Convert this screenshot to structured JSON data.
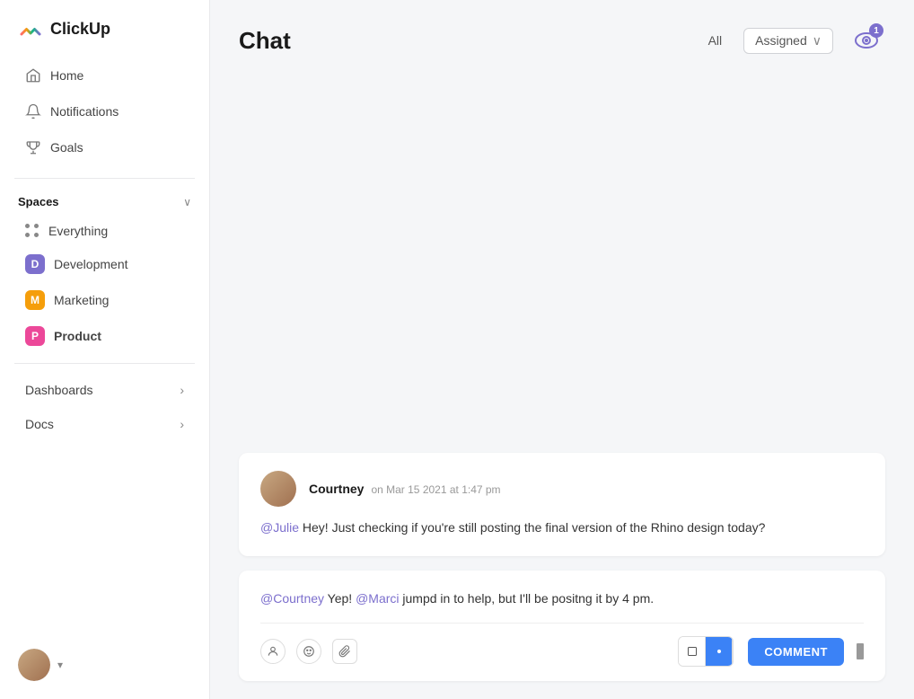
{
  "app": {
    "logo_text": "ClickUp"
  },
  "sidebar": {
    "nav_items": [
      {
        "id": "home",
        "label": "Home",
        "icon": "home"
      },
      {
        "id": "notifications",
        "label": "Notifications",
        "icon": "bell"
      },
      {
        "id": "goals",
        "label": "Goals",
        "icon": "trophy"
      }
    ],
    "spaces_label": "Spaces",
    "spaces_items": [
      {
        "id": "everything",
        "label": "Everything",
        "type": "dots"
      },
      {
        "id": "development",
        "label": "Development",
        "badge": "D",
        "color": "#7c6fcd"
      },
      {
        "id": "marketing",
        "label": "Marketing",
        "badge": "M",
        "color": "#f59e0b"
      },
      {
        "id": "product",
        "label": "Product",
        "badge": "P",
        "color": "#ec4899",
        "active": true
      }
    ],
    "sections": [
      {
        "id": "dashboards",
        "label": "Dashboards"
      },
      {
        "id": "docs",
        "label": "Docs"
      }
    ],
    "user_caret": "▾"
  },
  "main": {
    "title": "Chat",
    "filter_all": "All",
    "filter_assigned": "Assigned",
    "watch_count": "1"
  },
  "messages": [
    {
      "id": "msg1",
      "author": "Courtney",
      "time": "on Mar 15 2021 at 1:47 pm",
      "body_mention": "@Julie",
      "body_text": " Hey! Just checking if you're still posting the final version of the Rhino design today?"
    }
  ],
  "reply": {
    "mention1": "@Courtney",
    "text1": " Yep! ",
    "mention2": "@Marci",
    "text2": " jumpd in to help, but I'll be positng it by 4 pm.",
    "comment_label": "COMMENT"
  },
  "toolbar": {
    "person_icon": "👤",
    "circle_icon": "⊙",
    "paperclip_icon": "📎"
  }
}
